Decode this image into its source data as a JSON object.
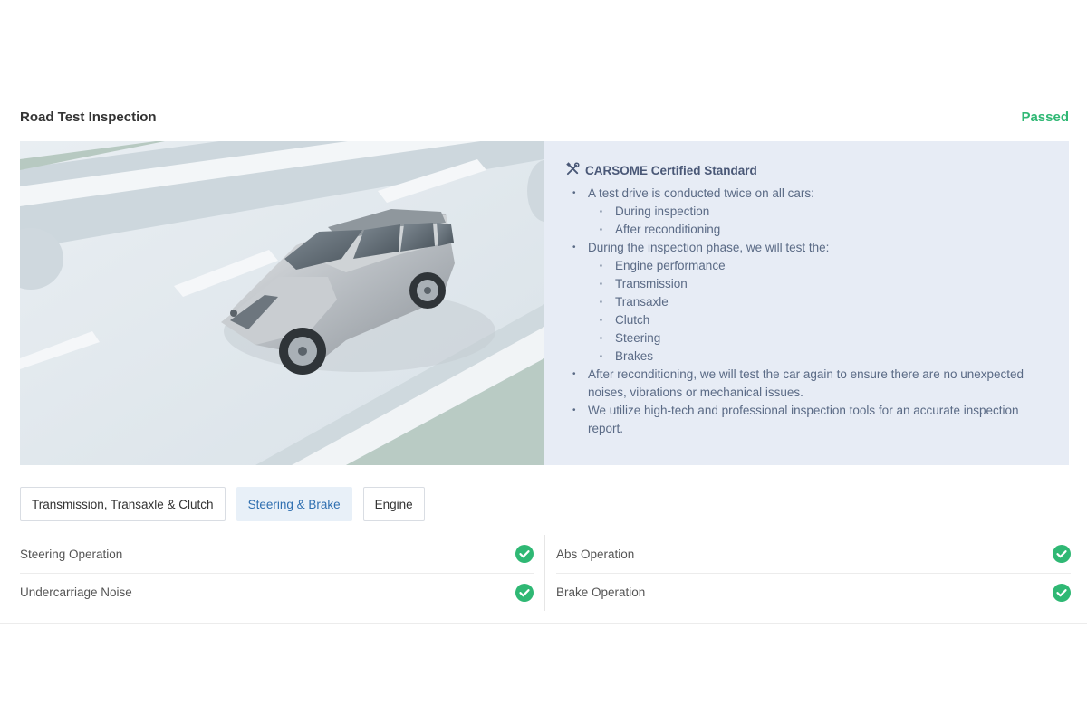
{
  "section": {
    "title": "Road Test Inspection",
    "status": "Passed",
    "status_color": "#2fb874"
  },
  "certification": {
    "icon": "tools-icon",
    "title": "CARSOME Certified Standard",
    "points": [
      {
        "text": "A test drive is conducted twice on all cars:",
        "sub": [
          "During inspection",
          "After reconditioning"
        ]
      },
      {
        "text": "During the inspection phase, we will test the:",
        "sub": [
          "Engine performance",
          "Transmission",
          "Transaxle",
          "Clutch",
          "Steering",
          "Brakes"
        ]
      },
      {
        "text": "After reconditioning, we will test the car again to ensure there are no unexpected noises, vibrations or mechanical issues.",
        "sub": []
      },
      {
        "text": "We utilize high-tech and professional inspection tools for an accurate inspection report.",
        "sub": []
      }
    ]
  },
  "tabs": [
    {
      "label": "Transmission, Transaxle & Clutch",
      "active": false
    },
    {
      "label": "Steering & Brake",
      "active": true
    },
    {
      "label": "Engine",
      "active": false
    }
  ],
  "results": {
    "left": [
      {
        "label": "Steering Operation",
        "status": "pass",
        "icon": "check-circle-icon"
      },
      {
        "label": "Undercarriage Noise",
        "status": "pass",
        "icon": "check-circle-icon"
      }
    ],
    "right": [
      {
        "label": "Abs Operation",
        "status": "pass",
        "icon": "check-circle-icon"
      },
      {
        "label": "Brake Operation",
        "status": "pass",
        "icon": "check-circle-icon"
      }
    ]
  }
}
